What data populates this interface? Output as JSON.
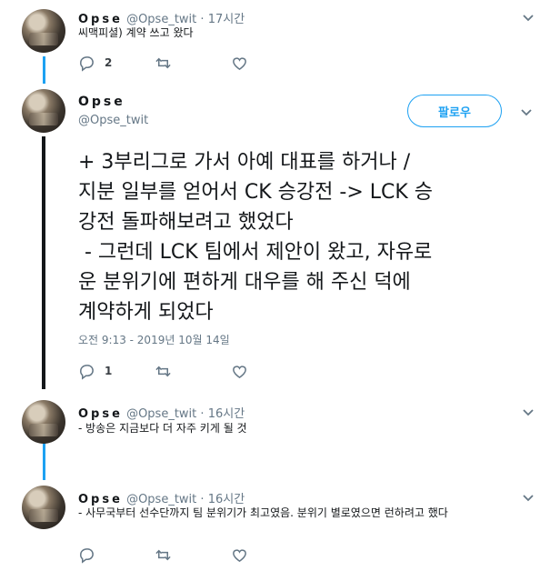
{
  "tweet1": {
    "name": "Opse",
    "handle": "@Opse_twit",
    "dot": "·",
    "time": "17시간",
    "text": "씨맥피셜) 계약 쓰고 왔다",
    "reply_count": "2",
    "retweet_count": "",
    "like_count": ""
  },
  "main": {
    "name": "Opse",
    "handle": "@Opse_twit",
    "follow_label": "팔로우",
    "text": "+ 3부리그로 가서 아예 대표를 하거나 /\n지분 일부를 얻어서 CK 승강전 -> LCK 승\n강전 돌파해보려고 했었다\n - 그런데 LCK 팀에서 제안이 왔고, 자유로\n운 분위기에 편하게 대우를 해 주신 덕에\n계약하게 되었다",
    "timestamp": "오전 9:13 - 2019년 10월 14일",
    "reply_count": "1",
    "retweet_count": "",
    "like_count": ""
  },
  "tweet3": {
    "name": "Opse",
    "handle": "@Opse_twit",
    "dot": "·",
    "time": "16시간",
    "text": "- 방송은 지금보다 더 자주 키게 될 것"
  },
  "tweet4": {
    "name": "Opse",
    "handle": "@Opse_twit",
    "dot": "·",
    "time": "16시간",
    "text": "- 사무국부터 선수단까지 팀 분위기가 최고였음. 분위기 별로였으면 런하려고 했다"
  },
  "icons": {
    "reply": "reply-icon",
    "retweet": "retweet-icon",
    "like": "heart-icon",
    "more": "chevron-down-icon"
  },
  "colors": {
    "accent": "#1da1f2",
    "muted": "#657786",
    "text": "#14171a"
  }
}
